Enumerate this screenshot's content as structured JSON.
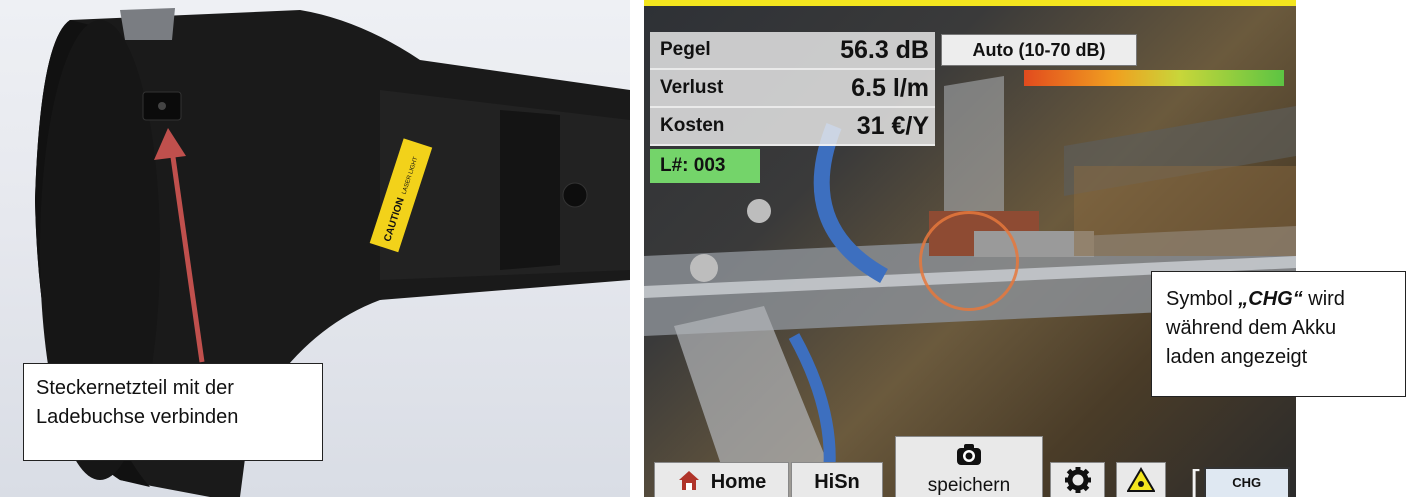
{
  "photo": {
    "callout_text_line1": "Steckernetzteil mit der",
    "callout_text_line2": "Ladebuchse verbinden",
    "sticker_title": "CAUTION",
    "sticker_sub": "LASER LIGHT",
    "arrow_color": "#c0504d"
  },
  "screen": {
    "accent_color": "#f3e51e",
    "readouts": [
      {
        "label": "Pegel",
        "value": "56.3 dB"
      },
      {
        "label": "Verlust",
        "value": "6.5 l/m"
      },
      {
        "label": "Kosten",
        "value": "31 €/Y"
      }
    ],
    "leak_number": "L#: 003",
    "range_button": "Auto (10-70 dB)",
    "toolbar": {
      "home_label": "Home",
      "hisn_label": "HiSn",
      "save_label": "speichern",
      "chg_label": "CHG"
    }
  },
  "callout_right": {
    "before": "Symbol ",
    "highlight": "„CHG“",
    "after": " wird",
    "line2": "während dem Akku",
    "line3": "laden angezeigt"
  }
}
